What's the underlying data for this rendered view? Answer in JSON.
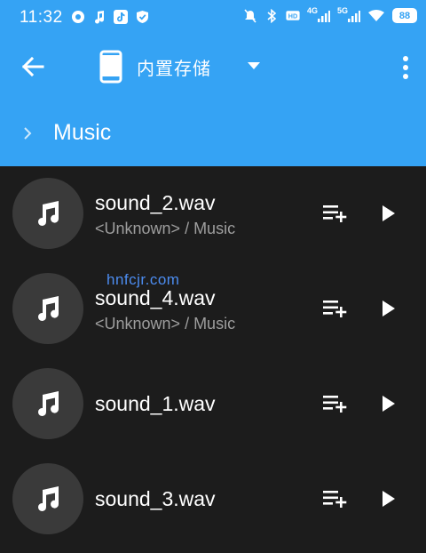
{
  "status_bar": {
    "time": "11:32",
    "network_a": "4G",
    "network_b": "5G",
    "battery": "88"
  },
  "app_bar": {
    "storage_label": "内置存储"
  },
  "breadcrumb": {
    "current_folder": "Music"
  },
  "files": [
    {
      "name": "sound_2.wav",
      "path": "<Unknown> / Music"
    },
    {
      "name": "sound_4.wav",
      "path": "<Unknown> / Music"
    },
    {
      "name": "sound_1.wav",
      "path": ""
    },
    {
      "name": "sound_3.wav",
      "path": ""
    }
  ],
  "watermark": "hnfcjr.com",
  "colors": {
    "accent": "#35a3f4",
    "background": "#1c1c1c",
    "thumb": "#3a3a3a",
    "secondary_text": "#9e9e9e"
  },
  "icons": {
    "back": "arrow-left",
    "storage": "smartphone",
    "dropdown": "triangle-down",
    "more": "vertical-dots",
    "thumb": "music-note",
    "queue": "playlist-add",
    "play": "play"
  }
}
